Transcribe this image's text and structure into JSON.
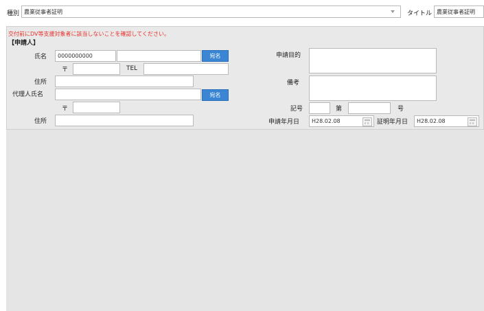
{
  "header": {
    "kind_label": "種別",
    "kind_value": "農業従事者証明",
    "title_label": "タイトル",
    "title_value": "農業従事者証明"
  },
  "form": {
    "warning": "交付前にDV等支援対象者に該当しないことを確認してください。",
    "section_title": "【申請人】",
    "name_label": "氏名",
    "name_code": "0000000000",
    "name_text": "",
    "name_button": "宛名",
    "postal_mark": "〒",
    "tel_label": "TEL",
    "address_label": "住所",
    "agent_label": "代理人氏名",
    "agent_button": "宛名",
    "agent_postal_mark": "〒",
    "agent_address_label": "住所",
    "purpose_label": "申請目的",
    "remarks_label": "備考",
    "symbol_label": "記号",
    "number_prefix": "第",
    "number_suffix": "号",
    "apply_date_label": "申請年月日",
    "apply_date": "H28.02.08",
    "cert_date_label": "証明年月日",
    "cert_date": "H28.02.08"
  },
  "colors": {
    "warning": "#e8302a",
    "button": "#3a86d4"
  }
}
